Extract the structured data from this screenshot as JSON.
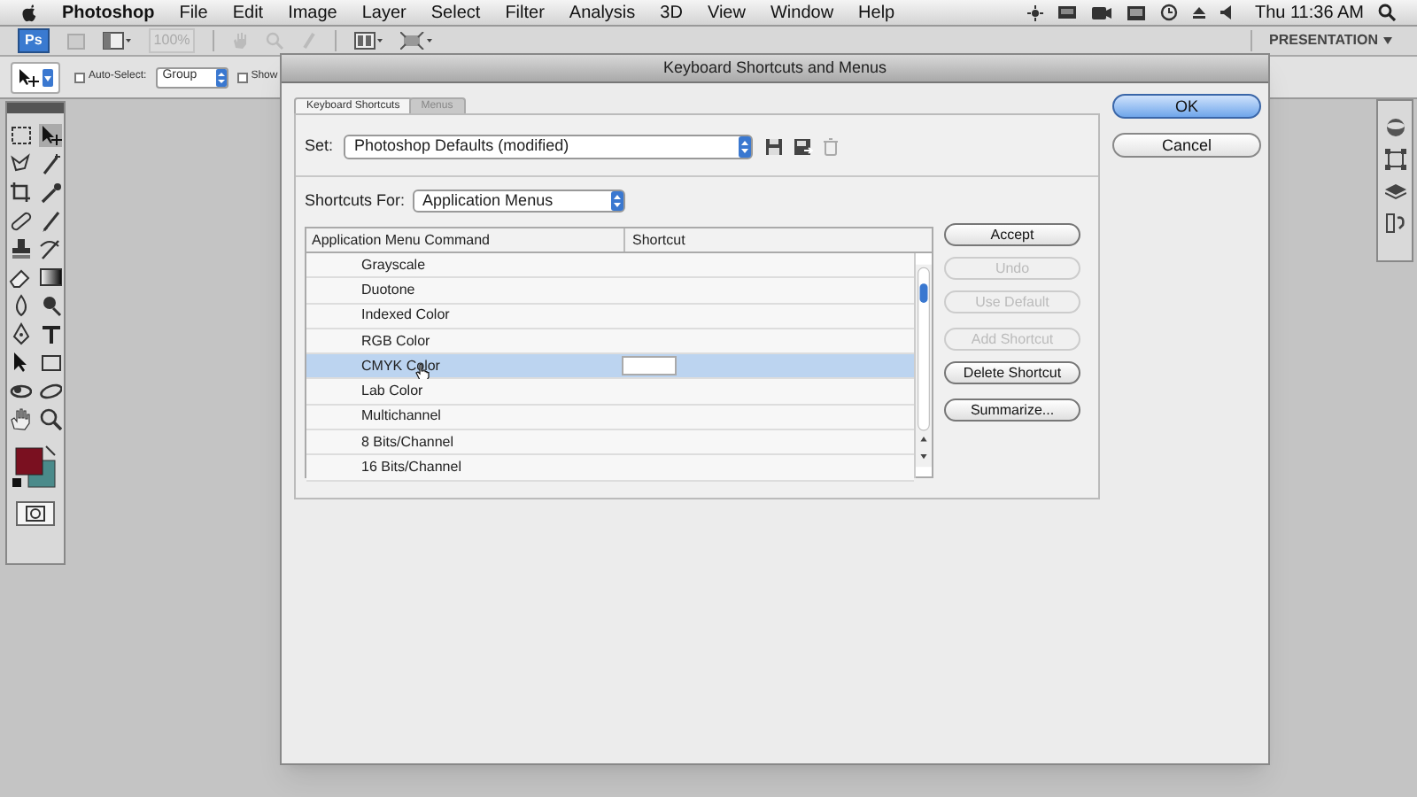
{
  "menubar": {
    "app": "Photoshop",
    "menus": [
      "File",
      "Edit",
      "Image",
      "Layer",
      "Select",
      "Filter",
      "Analysis",
      "3D",
      "View",
      "Window",
      "Help"
    ],
    "clock": "Thu 11:36 AM"
  },
  "app_bar": {
    "badge": "Ps",
    "zoom": "100%",
    "workspace": "PRESENTATION"
  },
  "options_bar": {
    "auto_select": {
      "label": "Auto-Select:",
      "checked": false
    },
    "target": "Group",
    "show": {
      "label": "Show",
      "checked": false
    }
  },
  "dialog": {
    "title": "Keyboard Shortcuts and Menus",
    "tabs": [
      {
        "label": "Keyboard Shortcuts",
        "selected": true
      },
      {
        "label": "Menus",
        "selected": false
      }
    ],
    "set": {
      "label": "Set:",
      "value": "Photoshop Defaults (modified)"
    },
    "shortcuts_for": {
      "label": "Shortcuts For:",
      "value": "Application Menus"
    },
    "columns": [
      "Application Menu Command",
      "Shortcut"
    ],
    "rows": [
      {
        "command": "Grayscale",
        "selected": false
      },
      {
        "command": "Duotone",
        "selected": false
      },
      {
        "command": "Indexed Color",
        "selected": false
      },
      {
        "command": "RGB Color",
        "selected": false
      },
      {
        "command": "CMYK Color",
        "selected": true
      },
      {
        "command": "Lab Color",
        "selected": false
      },
      {
        "command": "Multichannel",
        "selected": false
      },
      {
        "command": "8 Bits/Channel",
        "selected": false
      },
      {
        "command": "16 Bits/Channel",
        "selected": false
      }
    ],
    "actions": [
      {
        "label": "Accept",
        "disabled": false
      },
      {
        "label": "Undo",
        "disabled": true
      },
      {
        "label": "Use Default",
        "disabled": true
      },
      {
        "label": "Add Shortcut",
        "disabled": true
      },
      {
        "label": "Delete Shortcut",
        "disabled": false
      },
      {
        "label": "Summarize...",
        "disabled": false
      }
    ],
    "buttons": [
      {
        "label": "OK",
        "default": true
      },
      {
        "label": "Cancel",
        "default": false
      }
    ]
  }
}
